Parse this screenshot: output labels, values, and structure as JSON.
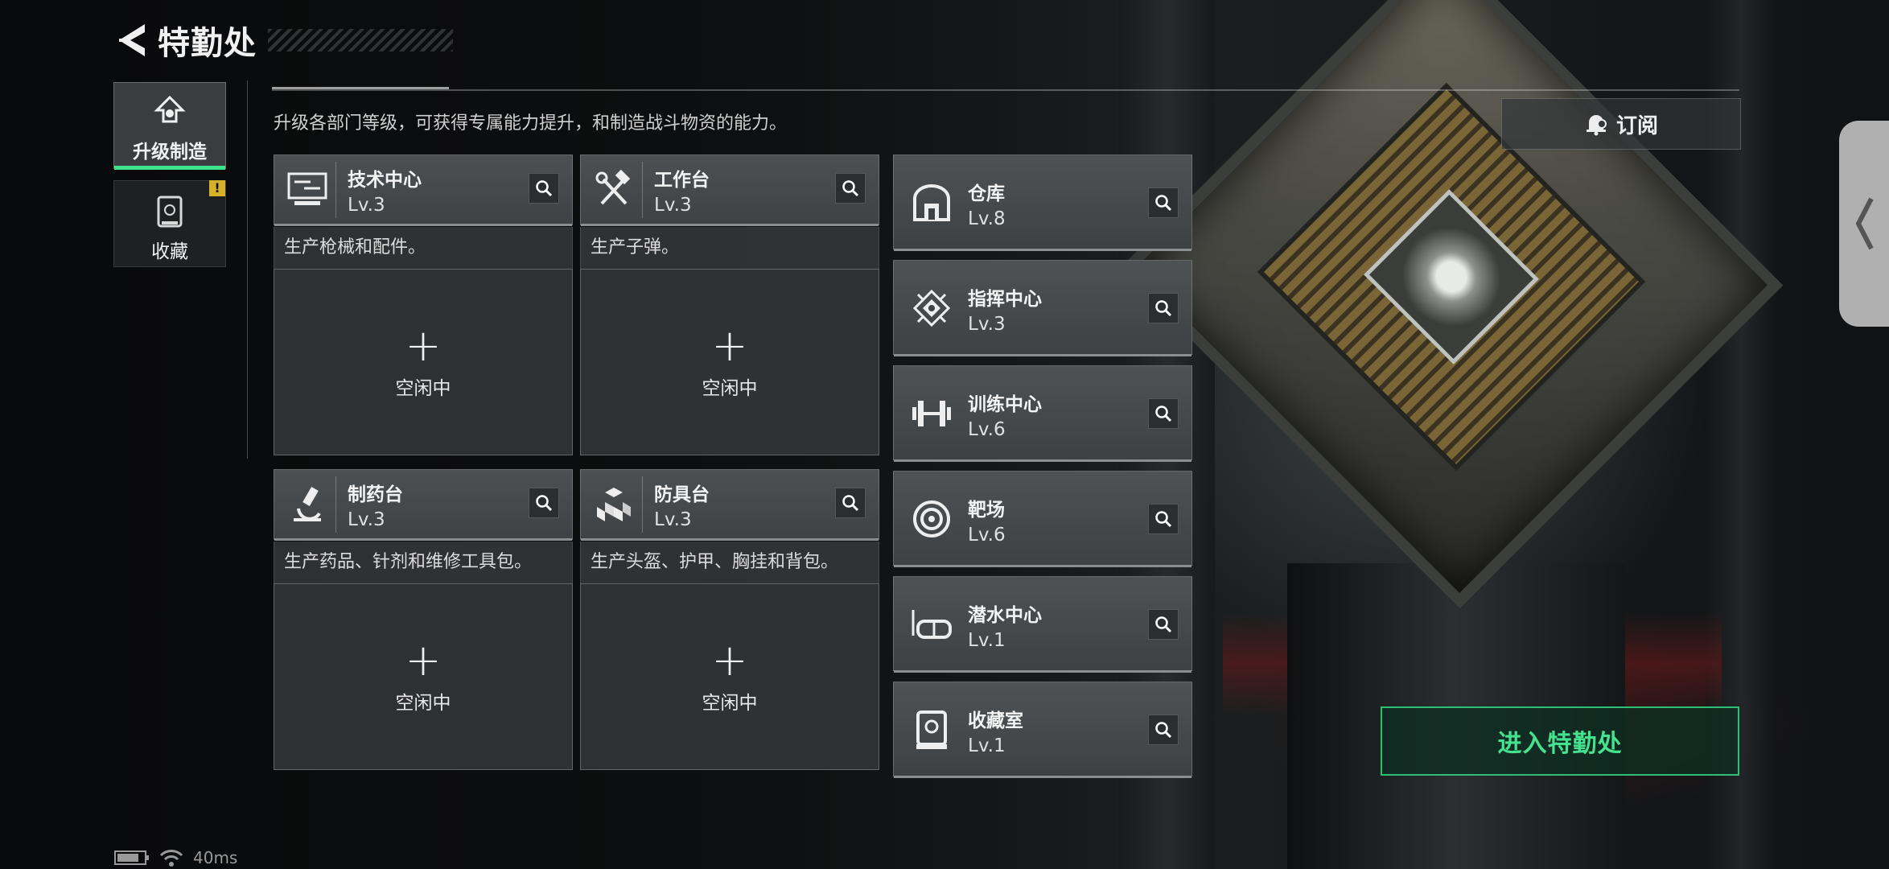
{
  "header": {
    "title": "特勤处"
  },
  "tabs": [
    {
      "label": "升级制造",
      "active": true,
      "icon": "upgrade-icon"
    },
    {
      "label": "收藏",
      "active": false,
      "icon": "collection-icon",
      "badge": "!"
    }
  ],
  "description": "升级各部门等级，可获得专属能力提升，和制造战斗物资的能力。",
  "workstations": [
    {
      "name": "技术中心",
      "level": "Lv.3",
      "desc": "生产枪械和配件。",
      "icon": "monitor-icon",
      "slot": {
        "plus": "+",
        "status": "空闲中"
      }
    },
    {
      "name": "工作台",
      "level": "Lv.3",
      "desc": "生产子弹。",
      "icon": "tools-icon",
      "slot": {
        "plus": "+",
        "status": "空闲中"
      }
    },
    {
      "name": "制药台",
      "level": "Lv.3",
      "desc": "生产药品、针剂和维修工具包。",
      "icon": "microscope-icon",
      "slot": {
        "plus": "+",
        "status": "空闲中"
      }
    },
    {
      "name": "防具台",
      "level": "Lv.3",
      "desc": "生产头盔、护甲、胸挂和背包。",
      "icon": "armor-boxes-icon",
      "slot": {
        "plus": "+",
        "status": "空闲中"
      }
    }
  ],
  "facilities": [
    {
      "name": "仓库",
      "level": "Lv.8",
      "icon": "warehouse-icon"
    },
    {
      "name": "指挥中心",
      "level": "Lv.3",
      "icon": "chip-icon"
    },
    {
      "name": "训练中心",
      "level": "Lv.6",
      "icon": "dumbbell-icon"
    },
    {
      "name": "靶场",
      "level": "Lv.6",
      "icon": "target-icon"
    },
    {
      "name": "潜水中心",
      "level": "Lv.1",
      "icon": "diving-mask-icon"
    },
    {
      "name": "收藏室",
      "level": "Lv.1",
      "icon": "display-case-icon"
    }
  ],
  "subscribe": {
    "label": "订阅",
    "icon": "bell-icon"
  },
  "enter_button": {
    "label": "进入特勤处"
  },
  "status": {
    "ping": "40ms"
  },
  "colors": {
    "accent": "#3ee28a",
    "enter_text": "#45e28f",
    "badge": "#d6b12b"
  }
}
